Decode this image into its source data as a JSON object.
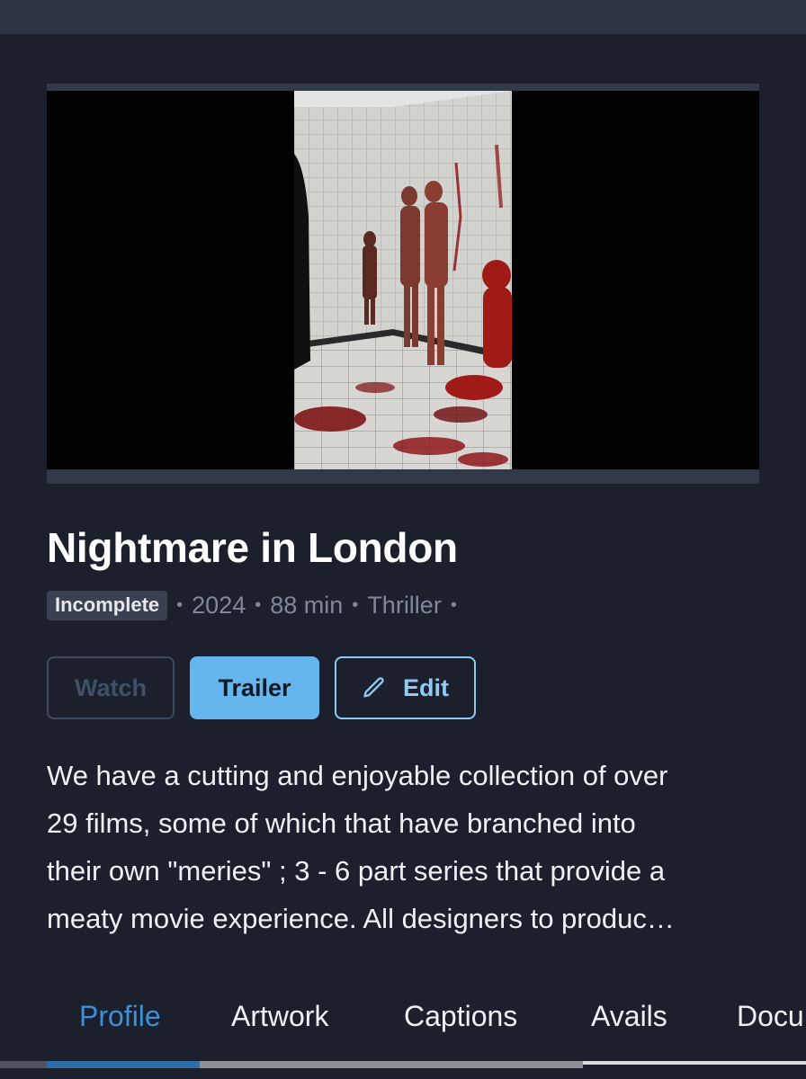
{
  "movie": {
    "title": "Nightmare in London",
    "status_badge": "Incomplete",
    "year": "2024",
    "runtime": "88 min",
    "genre": "Thriller",
    "meta_separator": "•"
  },
  "actions": {
    "watch_label": "Watch",
    "trailer_label": "Trailer",
    "edit_label": "Edit",
    "edit_icon": "pencil-icon"
  },
  "description": {
    "lines": [
      "We have a cutting and enjoyable collection of over",
      "29 films, some of which that have branched into",
      "their own \"meries\" ; 3 - 6 part series that provide a",
      "meaty movie experience. All designers to produc…"
    ]
  },
  "tabs": [
    {
      "label": "Profile",
      "active": true
    },
    {
      "label": "Artwork",
      "active": false
    },
    {
      "label": "Captions",
      "active": false
    },
    {
      "label": "Avails",
      "active": false
    },
    {
      "label": "Docu",
      "active": false
    }
  ],
  "colors": {
    "background": "#1b202c",
    "accent": "#66b6ee",
    "active_tab": "#3d8fd6",
    "muted_text": "#7f8899"
  }
}
